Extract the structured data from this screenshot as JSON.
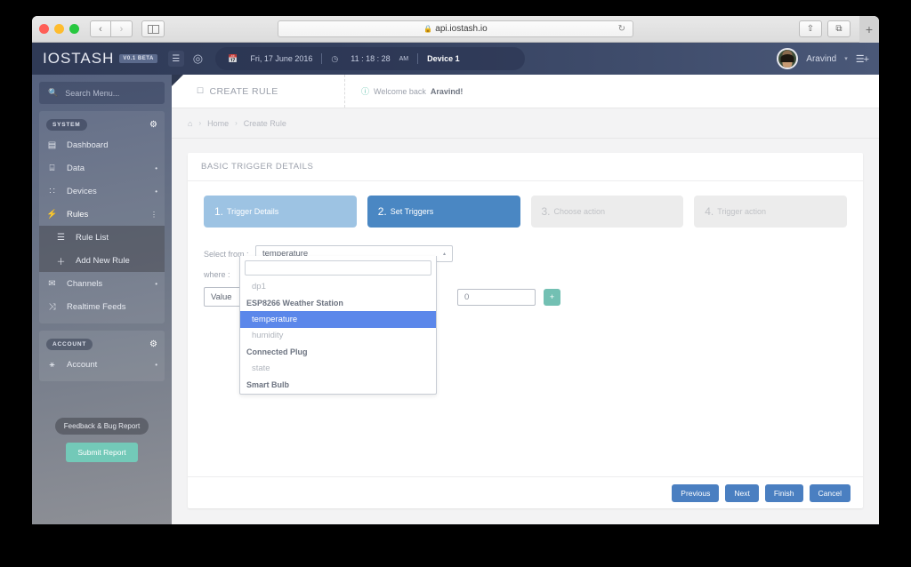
{
  "browser": {
    "url": "api.iostash.io",
    "lock_icon": "lock-icon",
    "back_label": "‹",
    "forward_label": "›",
    "reload_label": "↻",
    "share_label": "⇧",
    "tabs_label": "⧉",
    "new_tab_label": "+"
  },
  "topbar": {
    "logo": "IOSTASH",
    "beta_badge": "V0.1 BETA",
    "menu_icon_label": "☰",
    "globe_icon_label": "◎",
    "date": "Fri, 17 June 2016",
    "time": "11 : 18 : 28",
    "time_meridiem": "AM",
    "device": "Device 1",
    "calendar_icon": "calendar-icon",
    "clock_icon": "clock-icon",
    "user_name": "Aravind",
    "user_caret": "▾",
    "add_menu_label": "☰+"
  },
  "sidebar": {
    "search_placeholder": "Search Menu...",
    "search_icon": "search-icon",
    "groups": [
      {
        "tag": "SYSTEM",
        "gear": "⚙",
        "items": [
          {
            "label": "Dashboard",
            "icon": "▤",
            "bullet": ""
          },
          {
            "label": "Data",
            "icon": "⌸",
            "bullet": "•"
          },
          {
            "label": "Devices",
            "icon": "∷",
            "bullet": "•"
          },
          {
            "label": "Rules",
            "icon": "⚡",
            "bullet": "⋮"
          }
        ],
        "submenu": [
          {
            "label": "Rule List",
            "icon": "☰"
          },
          {
            "label": "Add New Rule",
            "icon": "＋"
          }
        ],
        "items_after": [
          {
            "label": "Channels",
            "icon": "✉",
            "bullet": "•"
          },
          {
            "label": "Realtime Feeds",
            "icon": "⤨",
            "bullet": ""
          }
        ]
      },
      {
        "tag": "ACCOUNT",
        "gear": "⚙",
        "items": [
          {
            "label": "Account",
            "icon": "⚹",
            "bullet": "•"
          }
        ],
        "submenu": [],
        "items_after": []
      }
    ],
    "feedback_label": "Feedback & Bug Report",
    "submit_label": "Submit Report"
  },
  "page": {
    "title": "CREATE RULE",
    "title_icon": "window-icon",
    "welcome_icon": "info-icon",
    "welcome_prefix": "Welcome back ",
    "welcome_user": "Aravind!",
    "breadcrumb": {
      "home_icon": "home-icon",
      "items": [
        "Home",
        "Create Rule"
      ],
      "separator": "›"
    }
  },
  "card": {
    "heading": "BASIC TRIGGER DETAILS",
    "steps": [
      {
        "num": "1.",
        "label": "Trigger Details",
        "state": "done"
      },
      {
        "num": "2.",
        "label": "Set Triggers",
        "state": "active"
      },
      {
        "num": "3.",
        "label": "Choose action",
        "state": "disabled"
      },
      {
        "num": "4.",
        "label": "Trigger action",
        "state": "disabled"
      }
    ],
    "form": {
      "select_from_label": "Select from :",
      "select_from_value": "temperature",
      "select_caret": "▴",
      "where_label": "where :",
      "operator_value": "Value",
      "number_value": "0",
      "add_button_label": "+",
      "dropdown_search_value": "",
      "dropdown_items": [
        {
          "text": "dp1",
          "type": "option",
          "selected": false
        },
        {
          "text": "ESP8266 Weather Station",
          "type": "group",
          "selected": false
        },
        {
          "text": "temperature",
          "type": "option",
          "selected": true
        },
        {
          "text": "humidity",
          "type": "option",
          "selected": false
        },
        {
          "text": "Connected Plug",
          "type": "group",
          "selected": false
        },
        {
          "text": "state",
          "type": "option",
          "selected": false
        },
        {
          "text": "Smart Bulb",
          "type": "group",
          "selected": false
        }
      ]
    },
    "footer_buttons": [
      "Previous",
      "Next",
      "Finish",
      "Cancel"
    ]
  },
  "colors": {
    "accent_blue": "#4a87c3",
    "step_done": "#9dc3e3",
    "teal": "#73c0b3",
    "dropdown_selected": "#5b87ea",
    "topbar_dark": "#2f3a56"
  }
}
